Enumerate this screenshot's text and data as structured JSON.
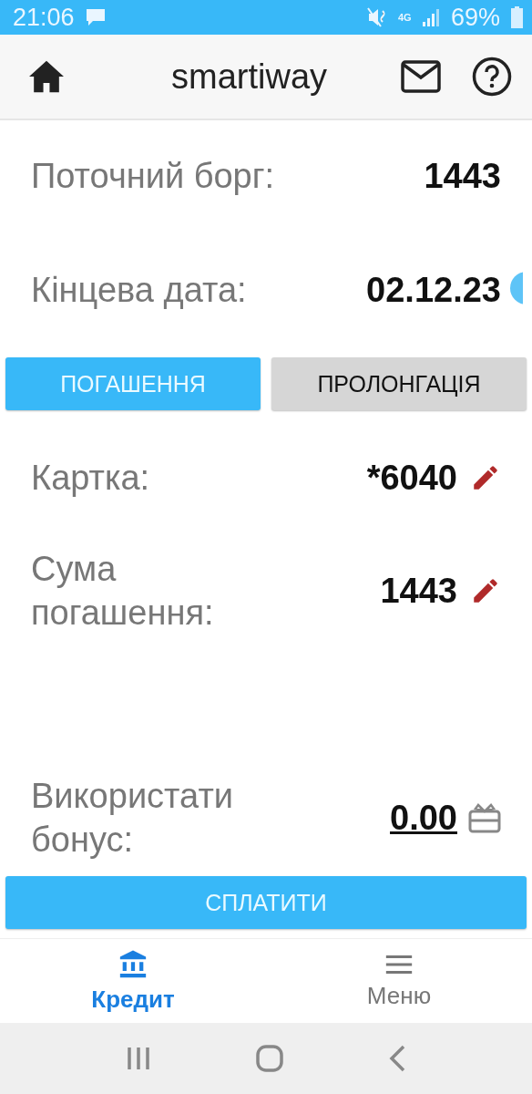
{
  "status_bar": {
    "time": "21:06",
    "battery": "69%",
    "network": "4G"
  },
  "header": {
    "title": "smartiway"
  },
  "debt": {
    "label": "Поточний борг:",
    "value": "1443"
  },
  "end_date": {
    "label": "Кінцева дата:",
    "value": "02.12.23"
  },
  "tabs": [
    {
      "label": "ПОГАШЕННЯ",
      "selected": true
    },
    {
      "label": "ПРОЛОНГАЦІЯ",
      "selected": false
    }
  ],
  "card": {
    "label": "Картка:",
    "value": "*6040"
  },
  "amount": {
    "label": "Сума погашення:",
    "value": "1443"
  },
  "bonus": {
    "label": "Використати бонус:",
    "value": "0.00"
  },
  "pay_button": "СПЛАТИТИ",
  "bottom_nav": [
    {
      "label": "Кредит",
      "kind": "bank",
      "selected": true
    },
    {
      "label": "Меню",
      "kind": "menu",
      "selected": false
    }
  ]
}
